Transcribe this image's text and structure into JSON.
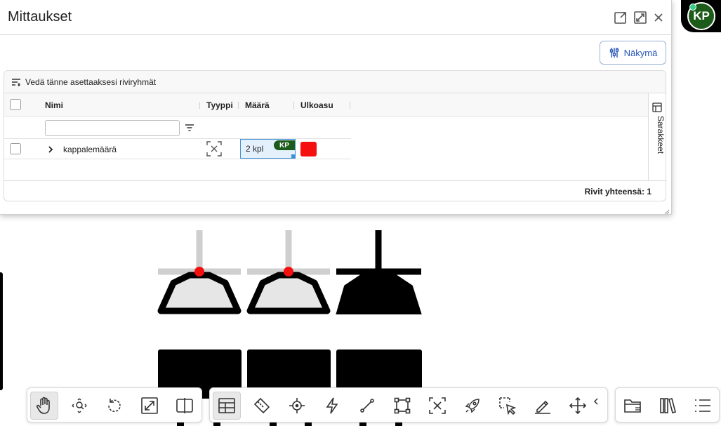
{
  "dialog": {
    "title": "Mittaukset",
    "view_button_label": "Näkymä",
    "group_bar_text": "Vedä tänne asettaaksesi riviryhmät",
    "columns": [
      "Nimi",
      "Tyyppi",
      "Määrä",
      "Ulkoasu"
    ],
    "side_panel_label": "Sarakkeet",
    "rows": [
      {
        "name": "kappalemäärä",
        "type_icon": "bounding-box-x-icon",
        "quantity": "2 kpl",
        "badge": "KP",
        "appearance_color": "#f50f0f"
      }
    ],
    "footer_text": "Rivit yhteensä: 1"
  },
  "user": {
    "initials": "KP",
    "status_color": "#33d08b",
    "avatar_color": "#1c5b1a"
  },
  "toolbar": {
    "group1": [
      "pan-hand-icon",
      "zoom-fit-icon",
      "rotate-icon",
      "expand-icon",
      "split-view-icon"
    ],
    "group2": [
      "table-icon",
      "measure-tape-icon",
      "crosshair-point-icon",
      "lightning-icon",
      "line-icon",
      "rectangle-icon",
      "box-x-icon",
      "rocket-icon",
      "select-arrow-icon",
      "pencil-icon",
      "move-icon",
      "collapse-chevron-icon"
    ],
    "group3": [
      "folder-icon",
      "library-icon",
      "list-icon"
    ]
  },
  "colors": {
    "accent": "#2a57b8",
    "marker": "#f50f0f",
    "highlight": "#3b8fd8"
  }
}
